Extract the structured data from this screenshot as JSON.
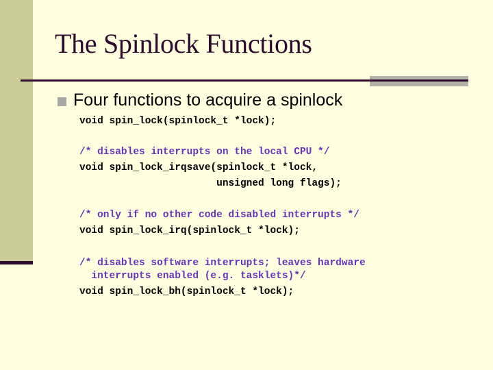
{
  "slide": {
    "title": "The Spinlock Functions",
    "bullet": "Four functions to acquire a spinlock",
    "code_lines": [
      {
        "text": "void spin_lock(spinlock_t *lock);",
        "kind": "code"
      },
      {
        "text": "/* disables interrupts on the local CPU */",
        "kind": "comment"
      },
      {
        "text": "void spin_lock_irqsave(spinlock_t *lock,",
        "kind": "code"
      },
      {
        "text": "                       unsigned long flags);",
        "kind": "code"
      },
      {
        "text": "/* only if no other code disabled interrupts */",
        "kind": "comment"
      },
      {
        "text": "void spin_lock_irq(spinlock_t *lock);",
        "kind": "code"
      },
      {
        "text": "/* disables software interrupts; leaves hardware",
        "kind": "comment"
      },
      {
        "text": "  interrupts enabled (e.g. tasklets)*/",
        "kind": "comment"
      },
      {
        "text": "void spin_lock_bh(spinlock_t *lock);",
        "kind": "code"
      }
    ]
  },
  "colors": {
    "background": "#FFFFDF",
    "sidebar": "#CCCC9A",
    "title": "#2E0A2E",
    "comment": "#6633BB",
    "bullet": "#A8A8A8"
  }
}
